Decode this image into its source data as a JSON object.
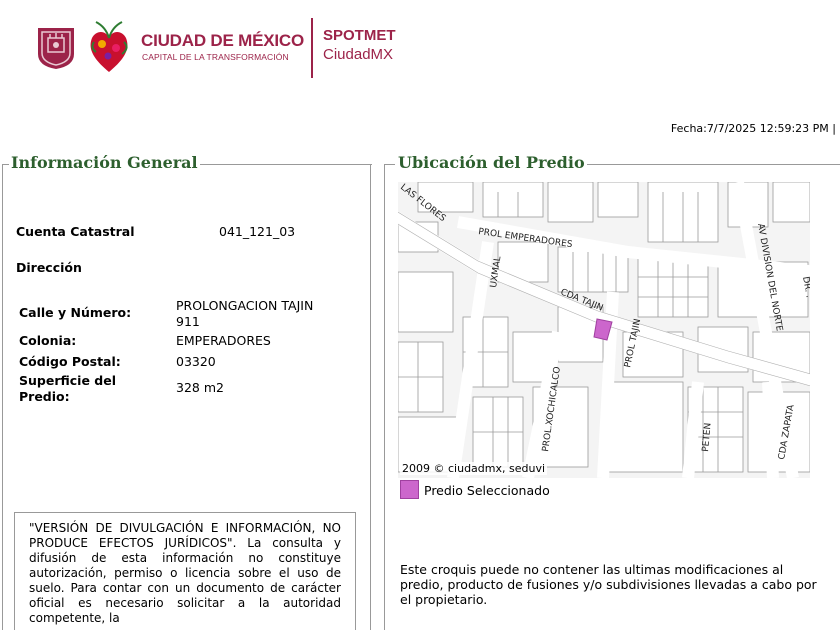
{
  "header": {
    "brand_title": "CIUDAD DE MÉXICO",
    "brand_subtitle": "CAPITAL DE LA TRANSFORMACIÓN",
    "app_title": "SPOTMET",
    "app_subtitle": "CiudadMX",
    "brand_color": "#9c2349"
  },
  "fecha": "Fecha:7/7/2025 12:59:23 PM |",
  "info_general": {
    "legend": "Información General",
    "cuenta_label": "Cuenta Catastral",
    "cuenta_value": "041_121_03",
    "direccion_label": "Dirección",
    "calle_label": "Calle y Número:",
    "calle_value_line1": "PROLONGACION TAJIN",
    "calle_value_line2": "911",
    "colonia_label": "Colonia:",
    "colonia_value": "EMPERADORES",
    "cp_label": "Código Postal:",
    "cp_value": "03320",
    "superficie_label_line1": "Superficie del",
    "superficie_label_line2": "Predio:",
    "superficie_value": "328 m2",
    "disclaimer": "\"VERSIÓN DE DIVULGACIÓN E INFORMACIÓN, NO PRODUCE EFECTOS JURÍDICOS\". La consulta y difusión de esta información no constituye autorización, permiso o licencia sobre el uso de suelo. Para contar con un documento de carácter oficial es necesario solicitar a la autoridad competente, la"
  },
  "ubicacion": {
    "legend": "Ubicación del Predio",
    "street_labels": {
      "las_flores": "LAS FLORES",
      "prol_emperadores": "PROL EMPERADORES",
      "uxmal": "UXMAL",
      "cda_tajin": "CDA TAJIN",
      "prol_tajin": "PROL TAJIN",
      "av_division": "AV DIVISION DEL NORTE",
      "prol_xochicalco": "PROL.XOCHICALCO",
      "peten": "PETEN",
      "cda_zapata": "CDA ZAPATA",
      "dr": "DR. ."
    },
    "copyright": "2009 © ciudadmx, seduvi",
    "legend_item": "Predio Seleccionado",
    "predio_color": "#cc66cc",
    "croquis_note": "Este croquis puede no contener las ultimas modificaciones al predio, producto de fusiones y/o subdivisiones llevadas a cabo por el propietario."
  }
}
